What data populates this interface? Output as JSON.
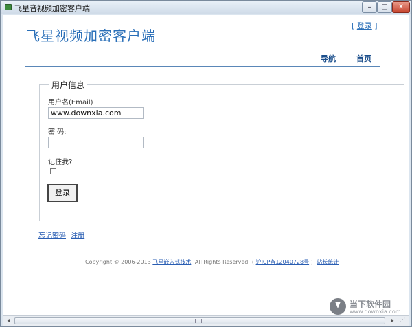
{
  "window": {
    "title": "飞星音视频加密客户端",
    "minimize": "–",
    "maximize": "□",
    "close": "✕"
  },
  "header": {
    "brand": "飞星视频加密客户端",
    "login_open": "[",
    "login_link": "登录",
    "login_close": "]"
  },
  "nav": {
    "guide": "导航",
    "home": "首页"
  },
  "form": {
    "legend": "用户信息",
    "username_label": "用户名(Email)",
    "username_value": "www.downxia.com",
    "password_label": "密 码:",
    "password_value": "",
    "remember_label": "记住我?",
    "remember_checked": false,
    "login_button": "登录"
  },
  "links": {
    "forgot": "忘记密码",
    "register": "注册"
  },
  "footer": {
    "copyright": "Copyright © 2006-2013",
    "company": "飞星嵌入式技术",
    "rights": "All Rights Reserved",
    "icp": "沪ICP备12040728号",
    "icp_open": "(",
    "icp_close": ")",
    "stats": "站长统计"
  },
  "watermark": {
    "name": "当下软件园",
    "url": "www.downxia.com"
  },
  "icons": {
    "app": "app-icon",
    "checkbox": "checkbox-icon",
    "download": "download-arrow-icon",
    "scroll_left": "chevron-left-icon",
    "scroll_right": "chevron-right-icon",
    "grip": "resize-grip-icon"
  },
  "colors": {
    "brand": "#2a6fb8",
    "nav": "#1c4f8c",
    "link": "#2a5eb3",
    "rule": "#5a87b8"
  }
}
